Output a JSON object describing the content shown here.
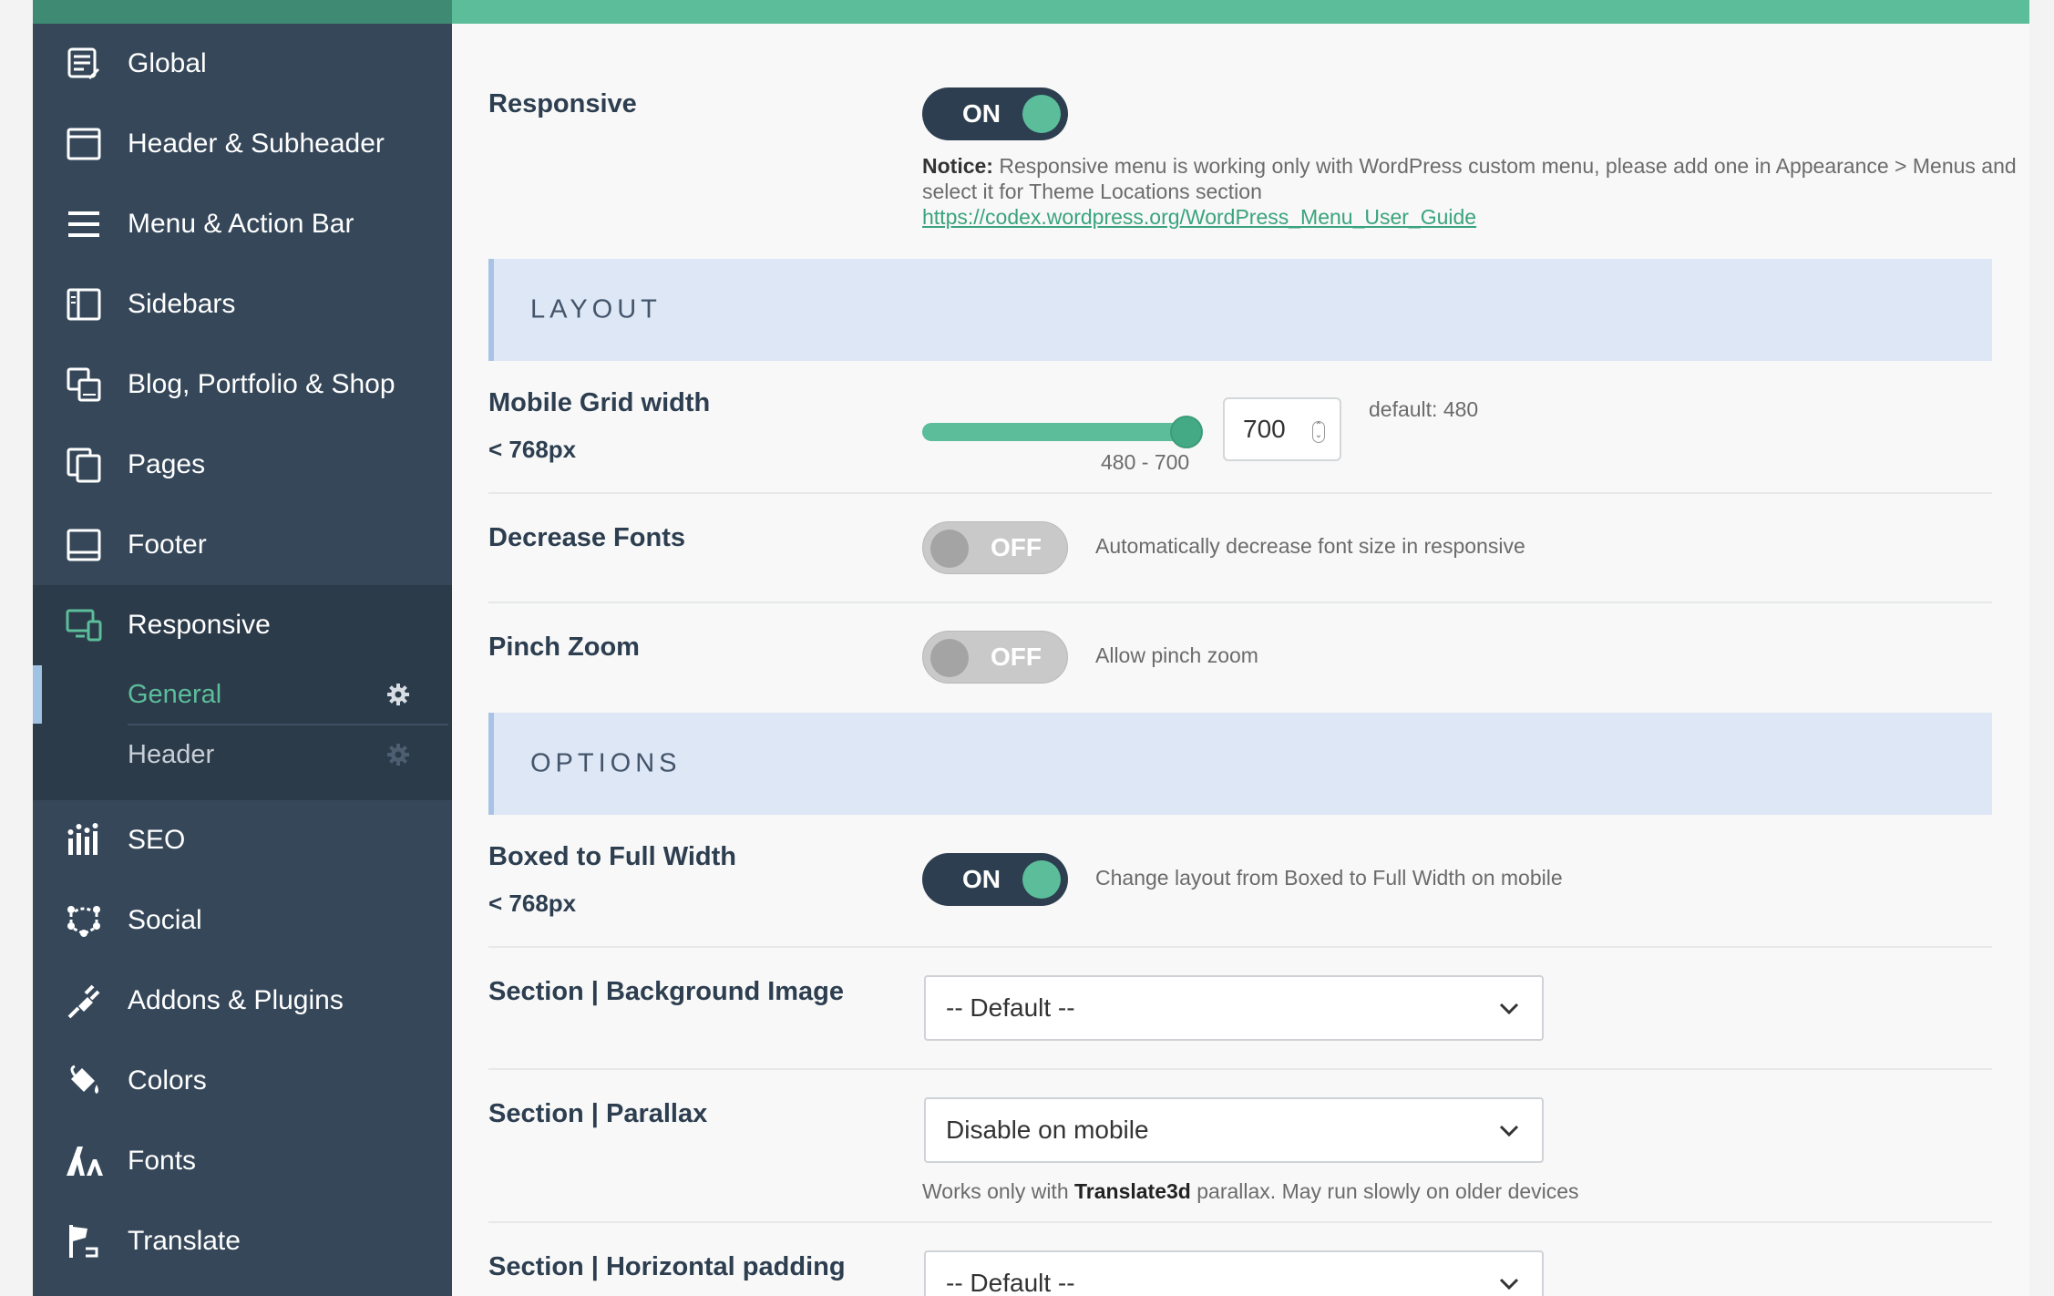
{
  "sidebar": {
    "items": [
      {
        "label": "Global",
        "icon": "global-settings-icon"
      },
      {
        "label": "Header & Subheader",
        "icon": "header-window-icon"
      },
      {
        "label": "Menu & Action Bar",
        "icon": "hamburger-menu-icon"
      },
      {
        "label": "Sidebars",
        "icon": "sidebar-layout-icon"
      },
      {
        "label": "Blog, Portfolio & Shop",
        "icon": "blog-portfolio-icon"
      },
      {
        "label": "Pages",
        "icon": "pages-icon"
      },
      {
        "label": "Footer",
        "icon": "footer-layout-icon"
      },
      {
        "label": "Responsive",
        "icon": "responsive-devices-icon"
      },
      {
        "label": "SEO",
        "icon": "seo-bars-icon"
      },
      {
        "label": "Social",
        "icon": "social-network-icon"
      },
      {
        "label": "Addons & Plugins",
        "icon": "plugin-icon"
      },
      {
        "label": "Colors",
        "icon": "paint-bucket-icon"
      },
      {
        "label": "Fonts",
        "icon": "fonts-icon"
      },
      {
        "label": "Translate",
        "icon": "translate-flag-icon"
      }
    ],
    "submenu": [
      {
        "label": "General",
        "current": true
      },
      {
        "label": "Header",
        "current": false
      }
    ]
  },
  "main": {
    "responsive": {
      "label": "Responsive",
      "toggle": "ON",
      "notice_title": "Notice:",
      "notice_text": " Responsive menu is working only with WordPress custom menu, please add one in Appearance > Menus and select it for Theme Locations section",
      "notice_link": "https://codex.wordpress.org/WordPress_Menu_User_Guide"
    },
    "layout_heading": "LAYOUT",
    "mobile_grid": {
      "label": "Mobile Grid width",
      "sub": "< 768px",
      "value": "700",
      "range_label": "480 - 700",
      "min": 480,
      "max": 700,
      "default_text": "default: 480"
    },
    "decrease_fonts": {
      "label": "Decrease Fonts",
      "toggle": "OFF",
      "desc": "Automatically decrease font size in responsive"
    },
    "pinch_zoom": {
      "label": "Pinch Zoom",
      "toggle": "OFF",
      "desc": "Allow pinch zoom"
    },
    "options_heading": "OPTIONS",
    "boxed": {
      "label": "Boxed to Full Width",
      "sub": "< 768px",
      "toggle": "ON",
      "desc": "Change layout from Boxed to Full Width on mobile"
    },
    "bg_image": {
      "label": "Section | Background Image",
      "value": "-- Default --"
    },
    "parallax": {
      "label": "Section | Parallax",
      "value": "Disable on mobile",
      "note_pre": "Works only with ",
      "note_bold": "Translate3d",
      "note_post": " parallax. May run slowly on older devices"
    },
    "h_padding": {
      "label": "Section | Horizontal padding",
      "value": "-- Default --"
    }
  },
  "colors": {
    "accent": "#5bbd9a",
    "sidebar": "#354759",
    "dark": "#2d3e50"
  }
}
